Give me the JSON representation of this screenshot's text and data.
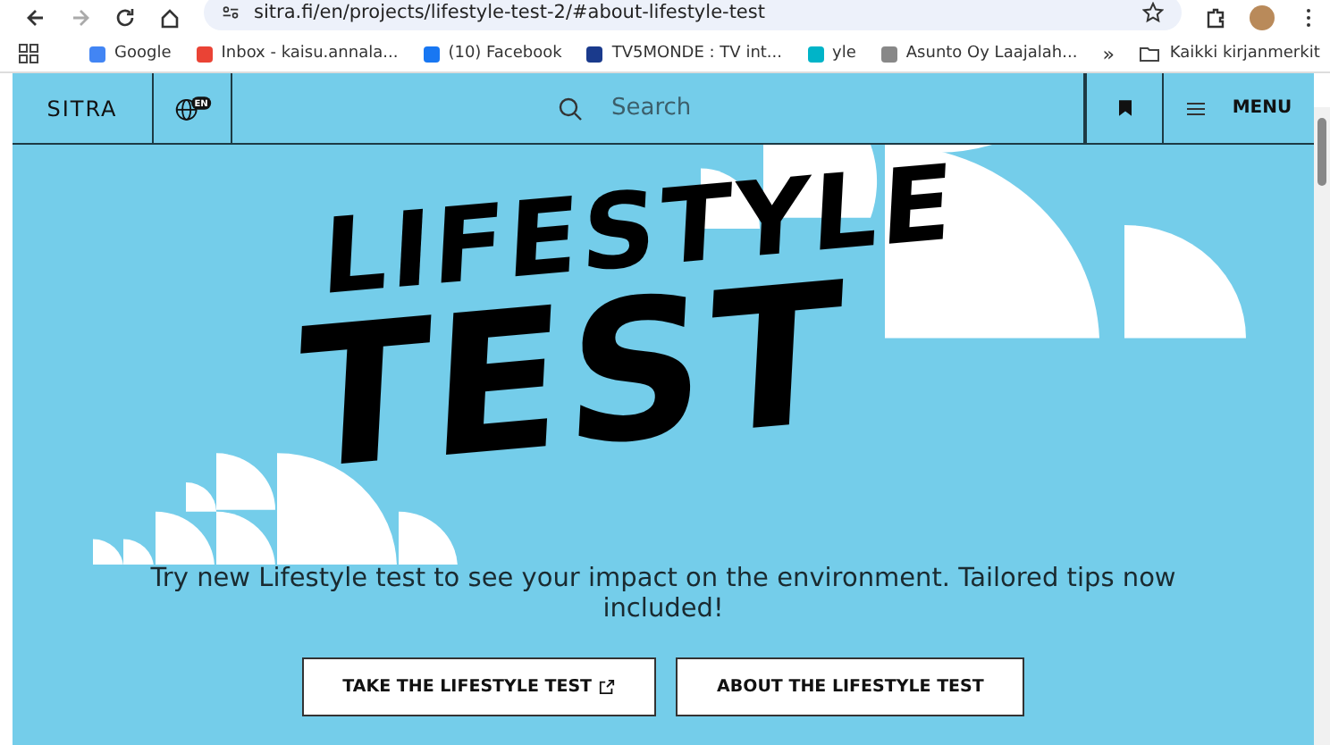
{
  "browser": {
    "url": "sitra.fi/en/projects/lifestyle-test-2/#about-lifestyle-test",
    "bookmarks": [
      {
        "label": "Google",
        "color": "#4285f4"
      },
      {
        "label": "Inbox - kaisu.annala...",
        "color": "#ea4335"
      },
      {
        "label": "(10) Facebook",
        "color": "#1877f2"
      },
      {
        "label": "TV5MONDE : TV int...",
        "color": "#1a3a8c"
      },
      {
        "label": "yle",
        "color": "#00b4c8"
      },
      {
        "label": "Asunto Oy Laajalah...",
        "color": "#888888"
      }
    ],
    "more": "»",
    "other_bookmarks": "Kaikki kirjanmerkit"
  },
  "header": {
    "logo": "SITRA",
    "language": "EN",
    "search": {
      "placeholder": "Search"
    },
    "menu": "MENU"
  },
  "hero": {
    "title_lines": [
      "LIFESTYLE",
      "TEST"
    ],
    "description": "Try new Lifestyle test to see your impact on the environment. Tailored tips now included!",
    "buttons": [
      {
        "label": "TAKE THE LIFESTYLE TEST",
        "external": true
      },
      {
        "label": "ABOUT THE LIFESTYLE TEST",
        "external": false
      }
    ]
  }
}
